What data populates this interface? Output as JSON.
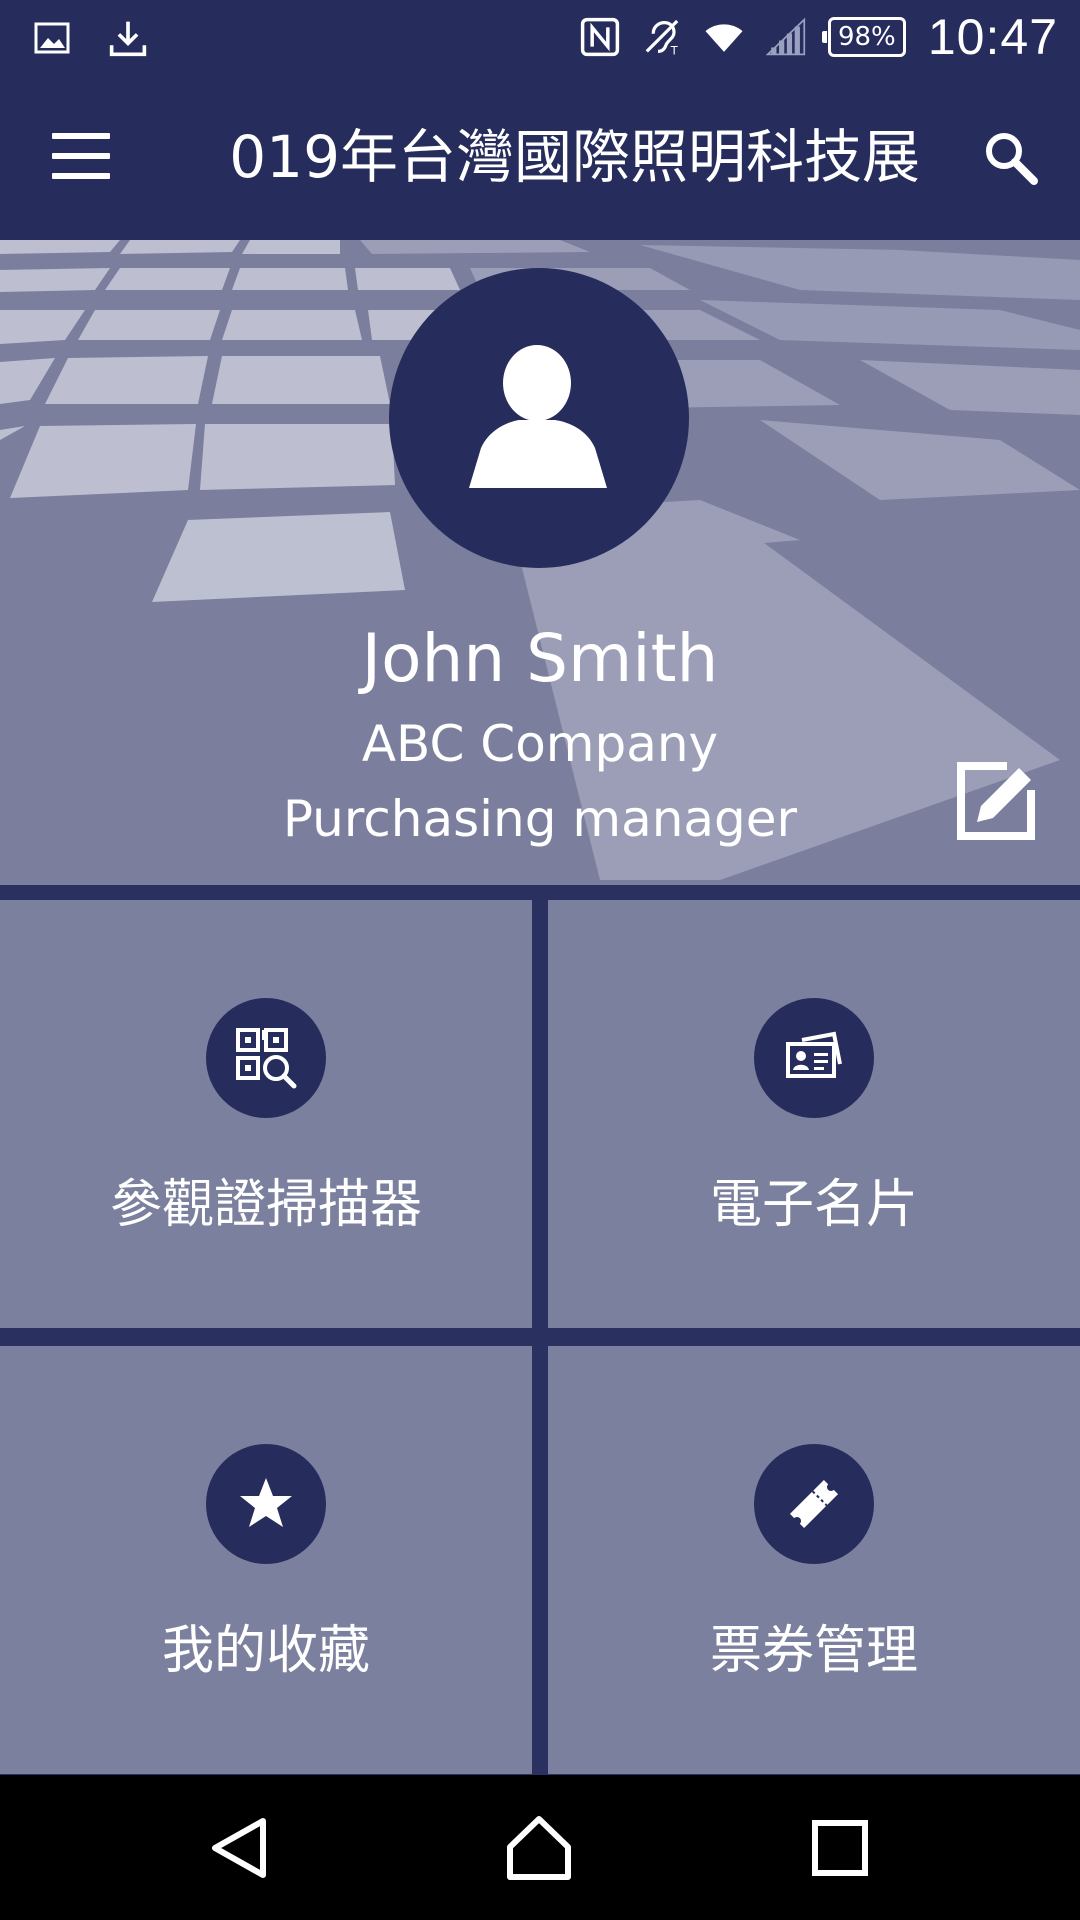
{
  "status_bar": {
    "battery": "98%",
    "time": "10:47",
    "left_icons": [
      "image-icon",
      "download-icon"
    ],
    "right_icons": [
      "nfc-icon",
      "hearing-aid-icon",
      "wifi-icon",
      "signal-icon",
      "battery-icon"
    ]
  },
  "app_bar": {
    "title": "019年台灣國際照明科技展",
    "menu_icon": "hamburger-menu-icon",
    "search_icon": "search-icon"
  },
  "profile": {
    "name": "John Smith",
    "company": "ABC Company",
    "title": "Purchasing manager",
    "edit_icon": "edit-icon"
  },
  "tiles": [
    {
      "label": "參觀證掃描器",
      "icon": "qr-scan-icon"
    },
    {
      "label": "電子名片",
      "icon": "business-card-icon"
    },
    {
      "label": "我的收藏",
      "icon": "star-icon"
    },
    {
      "label": "票券管理",
      "icon": "ticket-icon"
    }
  ],
  "nav_bar": {
    "back_icon": "back-icon",
    "home_icon": "home-icon",
    "recents_icon": "recents-icon"
  },
  "colors": {
    "primary_dark": "#262d5c",
    "tile_bg": "#7c809f",
    "nav_bg": "#000000"
  }
}
